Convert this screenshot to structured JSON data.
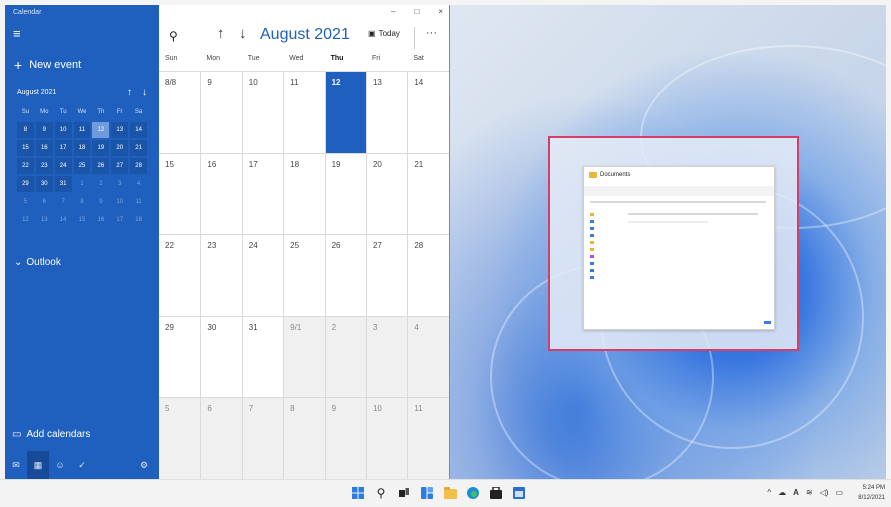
{
  "sidebar": {
    "app_title": "Calendar",
    "menu_icon": "hamburger-icon",
    "new_event": "New event",
    "mini_calendar": {
      "month_label": "August 2021",
      "weekdays": [
        "Su",
        "Mo",
        "Tu",
        "We",
        "Th",
        "Fr",
        "Sa"
      ],
      "weeks": [
        [
          "8",
          "9",
          "10",
          "11",
          "12",
          "13",
          "14"
        ],
        [
          "15",
          "16",
          "17",
          "18",
          "19",
          "20",
          "21"
        ],
        [
          "22",
          "23",
          "24",
          "25",
          "26",
          "27",
          "28"
        ],
        [
          "29",
          "30",
          "31",
          "1",
          "2",
          "3",
          "4"
        ],
        [
          "5",
          "6",
          "7",
          "8",
          "9",
          "10",
          "11"
        ],
        [
          "12",
          "13",
          "14",
          "15",
          "16",
          "17",
          "18"
        ]
      ]
    },
    "outlook_label": "Outlook",
    "add_calendars": "Add calendars",
    "bottom_icons": [
      "mail-icon",
      "calendar-icon",
      "people-icon",
      "todo-icon",
      "settings-icon"
    ]
  },
  "window": {
    "minimize": "–",
    "maximize": "□",
    "close": "×"
  },
  "toolbar": {
    "month_title": "August 2021",
    "today_label": "Today",
    "more_label": "···"
  },
  "month_view": {
    "weekdays": [
      "Sun",
      "Mon",
      "Tue",
      "Wed",
      "Thu",
      "Fri",
      "Sat"
    ],
    "weeks": [
      [
        "8/8",
        "9",
        "10",
        "11",
        "12",
        "13",
        "14"
      ],
      [
        "15",
        "16",
        "17",
        "18",
        "19",
        "20",
        "21"
      ],
      [
        "22",
        "23",
        "24",
        "25",
        "26",
        "27",
        "28"
      ],
      [
        "29",
        "30",
        "31",
        "9/1",
        "2",
        "3",
        "4"
      ],
      [
        "5",
        "6",
        "7",
        "8",
        "9",
        "10",
        "11"
      ]
    ]
  },
  "snap_preview": {
    "window_title": "Documents"
  },
  "taskbar": {
    "apps": [
      "start-icon",
      "search-icon",
      "task-view-icon",
      "widgets-icon",
      "file-explorer-icon",
      "edge-icon",
      "store-icon",
      "calendar-app-icon"
    ],
    "tray_text": "^",
    "lang": "A",
    "time": "5:24 PM",
    "date": "8/12/2021"
  }
}
